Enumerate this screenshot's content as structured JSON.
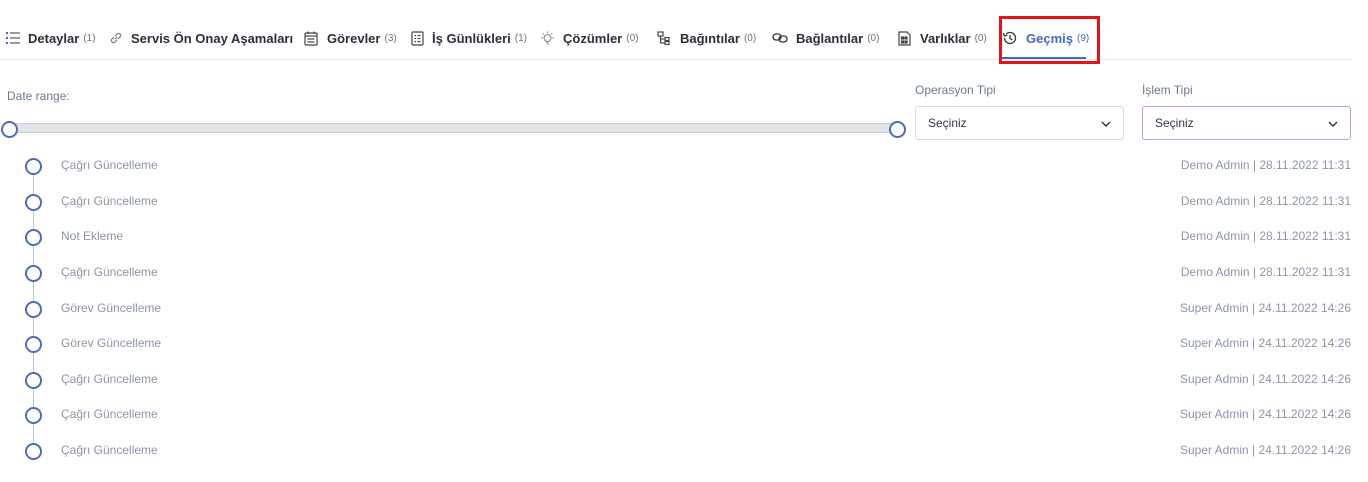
{
  "tabs": [
    {
      "label": "Detaylar",
      "count": "(1)",
      "icon": "list-icon"
    },
    {
      "label": "Servis Ön Onay Aşamaları",
      "count": "",
      "icon": "link-icon"
    },
    {
      "label": "Görevler",
      "count": "(3)",
      "icon": "calendar-icon"
    },
    {
      "label": "İş Günlükleri",
      "count": "(1)",
      "icon": "worklog-icon"
    },
    {
      "label": "Çözümler",
      "count": "(0)",
      "icon": "lightbulb-icon"
    },
    {
      "label": "Bağıntılar",
      "count": "(0)",
      "icon": "relation-icon"
    },
    {
      "label": "Bağlantılar",
      "count": "(0)",
      "icon": "chain-icon"
    },
    {
      "label": "Varlıklar",
      "count": "(0)",
      "icon": "asset-icon"
    },
    {
      "label": "Geçmiş",
      "count": "(9)",
      "icon": "history-icon",
      "active": true
    }
  ],
  "filters": {
    "date_range_label": "Date range:",
    "operation_type": {
      "label": "Operasyon Tipi",
      "value": "Seçiniz"
    },
    "transaction_type": {
      "label": "İşlem Tipi",
      "value": "Seçiniz"
    }
  },
  "history": [
    {
      "title": "Çağrı Güncelleme",
      "meta": "Demo Admin | 28.11.2022 11:31"
    },
    {
      "title": "Çağrı Güncelleme",
      "meta": "Demo Admin | 28.11.2022 11:31"
    },
    {
      "title": "Not Ekleme",
      "meta": "Demo Admin | 28.11.2022 11:31"
    },
    {
      "title": "Çağrı Güncelleme",
      "meta": "Demo Admin | 28.11.2022 11:31"
    },
    {
      "title": "Görev Güncelleme",
      "meta": "Super Admin | 24.11.2022 14:26"
    },
    {
      "title": "Görev Güncelleme",
      "meta": "Super Admin | 24.11.2022 14:26"
    },
    {
      "title": "Çağrı Güncelleme",
      "meta": "Super Admin | 24.11.2022 14:26"
    },
    {
      "title": "Çağrı Güncelleme",
      "meta": "Super Admin | 24.11.2022 14:26"
    },
    {
      "title": "Çağrı Güncelleme",
      "meta": "Super Admin | 24.11.2022 14:26"
    }
  ],
  "colors": {
    "accent": "#4a66c9",
    "highlight": "#e0141c",
    "muted_text": "#8c96a8"
  }
}
